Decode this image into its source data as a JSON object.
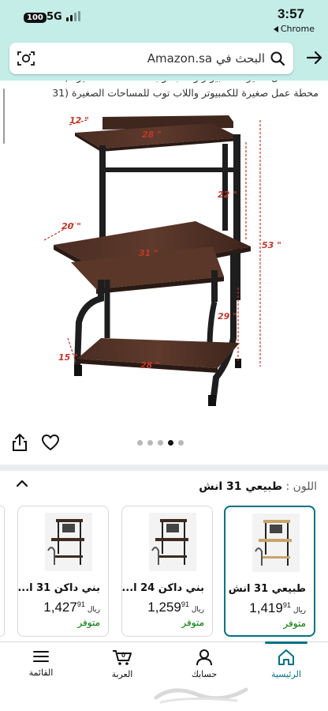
{
  "status_bar": {
    "battery": "100",
    "network": "5G",
    "time": "3:57",
    "app": "Chrome"
  },
  "search": {
    "placeholder": "البحث في Amazon.sa"
  },
  "product": {
    "title_lines": [
      "محطة عمل صغيرة للكمبيوتر واللاب توب للمساحات الصغيرة (31"
    ]
  },
  "dimensions": {
    "shelf_depth": "12 \"",
    "shelf_width": "28 \"",
    "riser_height": "22 \"",
    "desk_depth": "20 \"",
    "desk_width": "31 \"",
    "total_height": "53 \"",
    "desk_height": "29 \"",
    "base_height": "15 \"",
    "base_width": "28 \""
  },
  "gallery": {
    "image_count": 5,
    "active_index": 3
  },
  "color_section": {
    "label": "اللون :",
    "value": "طبيعي 31 انش"
  },
  "variants": [
    {
      "name": "طبيعي 31 انش",
      "currency": "ريال",
      "price_whole": "1,419",
      "price_fraction": "91",
      "status": "متوفر",
      "selected": true,
      "finish": "#c9a46a"
    },
    {
      "name": "بني داكن 24 ا...",
      "currency": "ريال",
      "price_whole": "1,259",
      "price_fraction": "91",
      "status": "متوفر",
      "selected": false,
      "finish": "#3e2a1e"
    },
    {
      "name": "بني داكن 31 ا...",
      "currency": "ريال",
      "price_whole": "1,427",
      "price_fraction": "91",
      "status": "متوفر",
      "selected": false,
      "finish": "#3e2a1e"
    }
  ],
  "nav": {
    "items": [
      {
        "label": "الرئيسية",
        "icon": "home-icon",
        "active": true
      },
      {
        "label": "حسابك",
        "icon": "user-icon",
        "active": false
      },
      {
        "label": "العربة",
        "icon": "cart-icon",
        "active": false,
        "count": "0"
      },
      {
        "label": "القائمة",
        "icon": "menu-icon",
        "active": false
      }
    ]
  },
  "colors": {
    "header_bg": "#c5ede8",
    "accent": "#007185",
    "in_stock": "#007600",
    "dimension_red": "#c0392b"
  }
}
